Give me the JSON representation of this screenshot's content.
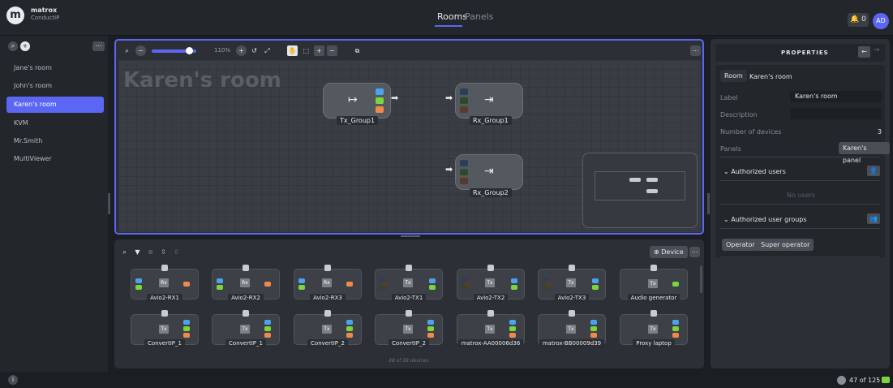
{
  "brand": {
    "name": "matrox",
    "product": "ConductIP"
  },
  "nav": {
    "rooms": "Rooms",
    "panels": "Panels"
  },
  "header": {
    "notif_count": "0",
    "avatar": "AD"
  },
  "sidebar": {
    "rooms": [
      "Jane's room",
      "John's room",
      "Karen's room",
      "KVM",
      "Mr.Smith",
      "MultiViewer"
    ]
  },
  "canvas": {
    "zoom": "110%",
    "room_title": "Karen's room",
    "nodes": {
      "tx": "Tx_Group1",
      "rx1": "Rx_Group1",
      "rx2": "Rx_Group2"
    },
    "port_count": "1"
  },
  "devices": {
    "add_label": "Device",
    "count_text": "38 of 38 devices",
    "row1": [
      "Avio2-RX1",
      "Avio2-RX2",
      "Avio2-RX3",
      "Avio2-TX1",
      "Avio2-TX2",
      "Avio2-TX3",
      "Audio generator"
    ],
    "row2": [
      "ConvertIP_1",
      "ConvertIP_1",
      "ConvertIP_2",
      "ConvertIP_2",
      "matrox-AA00006d36",
      "matrox-BB00009d39",
      "Proxy laptop"
    ],
    "tx_glyph": "Tx",
    "rx_glyph": "Rx",
    "tx_small": "Tx"
  },
  "properties": {
    "title": "PROPERTIES",
    "tag": "Room",
    "room_name": "Karen's room",
    "label_key": "Label",
    "label_value": "Karen's room",
    "description_key": "Description",
    "description_value": "",
    "devices_key": "Number of devices",
    "devices_value": "3",
    "panels_key": "Panels",
    "panels_value": "Karen's panel",
    "auth_users": "Authorized users",
    "no_users": "No users",
    "auth_groups": "Authorized user groups",
    "groups": [
      "Operator",
      "Super operator"
    ]
  },
  "status": {
    "licenses": "47 of 125"
  },
  "colors": {
    "accent": "#5b67f2",
    "port_blue": "#4aa3ef",
    "port_green": "#7bd63d",
    "port_orange": "#ef8a4a"
  }
}
